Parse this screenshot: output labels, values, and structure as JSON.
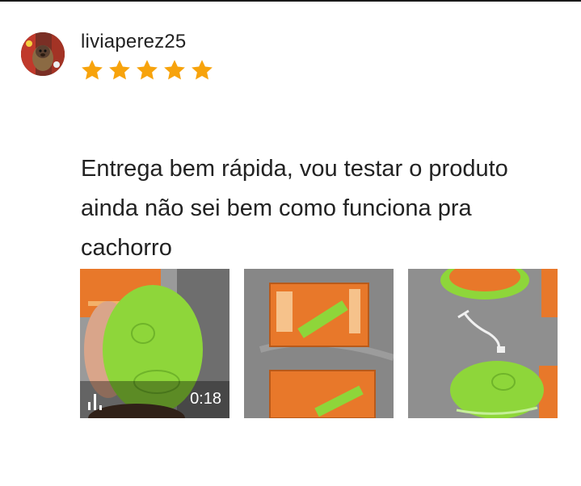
{
  "review": {
    "username": "liviaperez25",
    "rating": 5,
    "rating_max": 5,
    "star_color": "#f7a30c",
    "text": "Entrega bem rápida, vou testar o produto ainda não sei bem como funciona pra cachorro"
  },
  "media": [
    {
      "type": "video",
      "duration": "0:18",
      "icon": "video-bars-icon"
    },
    {
      "type": "image"
    },
    {
      "type": "image"
    }
  ],
  "colors": {
    "text": "#222222",
    "background": "#ffffff",
    "product_green": "#8ed63a",
    "box_orange": "#e8782a"
  }
}
